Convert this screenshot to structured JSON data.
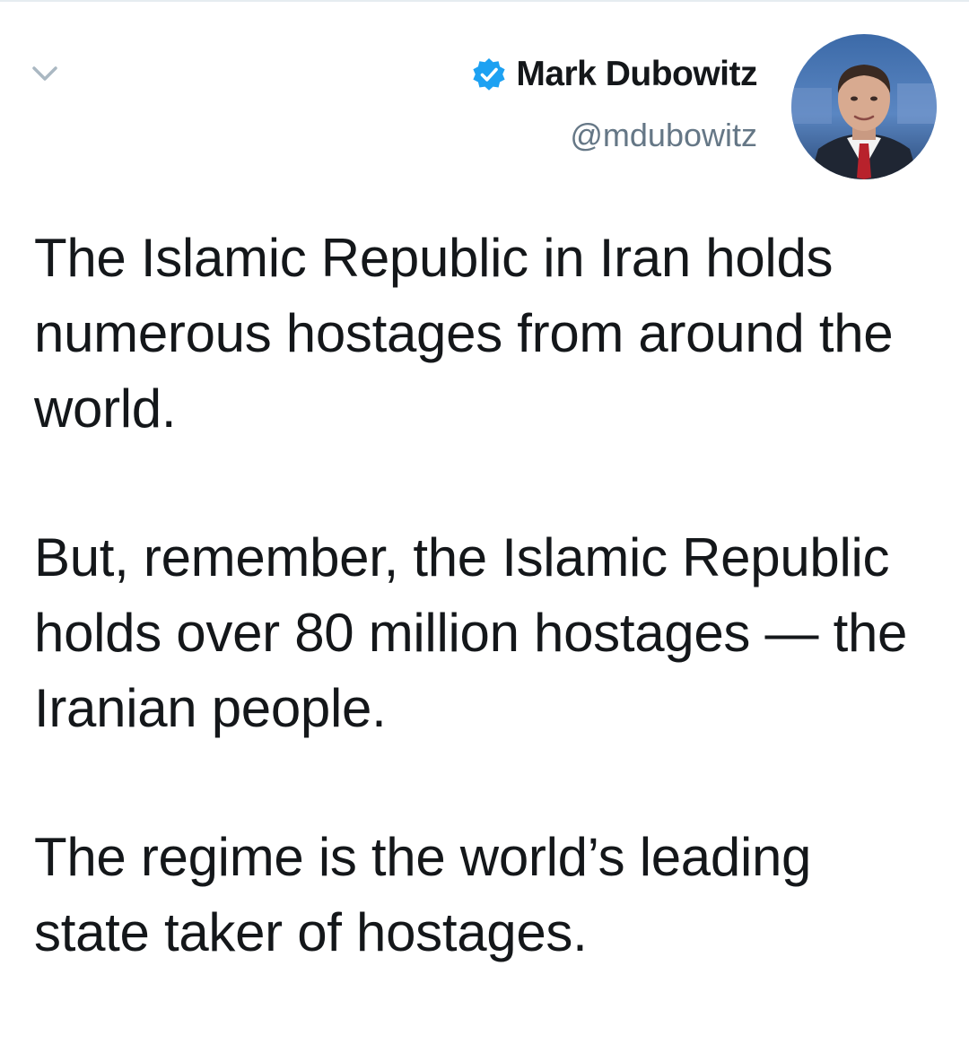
{
  "tweet": {
    "author": {
      "display_name": "Mark Dubowitz",
      "handle": "@mdubowitz",
      "verified": true,
      "verified_icon": "verified-badge-icon",
      "avatar": "profile-photo"
    },
    "menu_icon": "chevron-down-icon",
    "paragraphs": [
      "The Islamic Republic in Iran holds numerous hostages from around the world.",
      "But, remember, the Islamic Republic holds over 80 million hostages — the Iranian people.",
      "The regime is the world’s leading state taker of hostages."
    ]
  },
  "colors": {
    "text": "#14171a",
    "secondary_text": "#657786",
    "verified_blue": "#1da1f2",
    "caret_gray": "#aab8c2"
  }
}
